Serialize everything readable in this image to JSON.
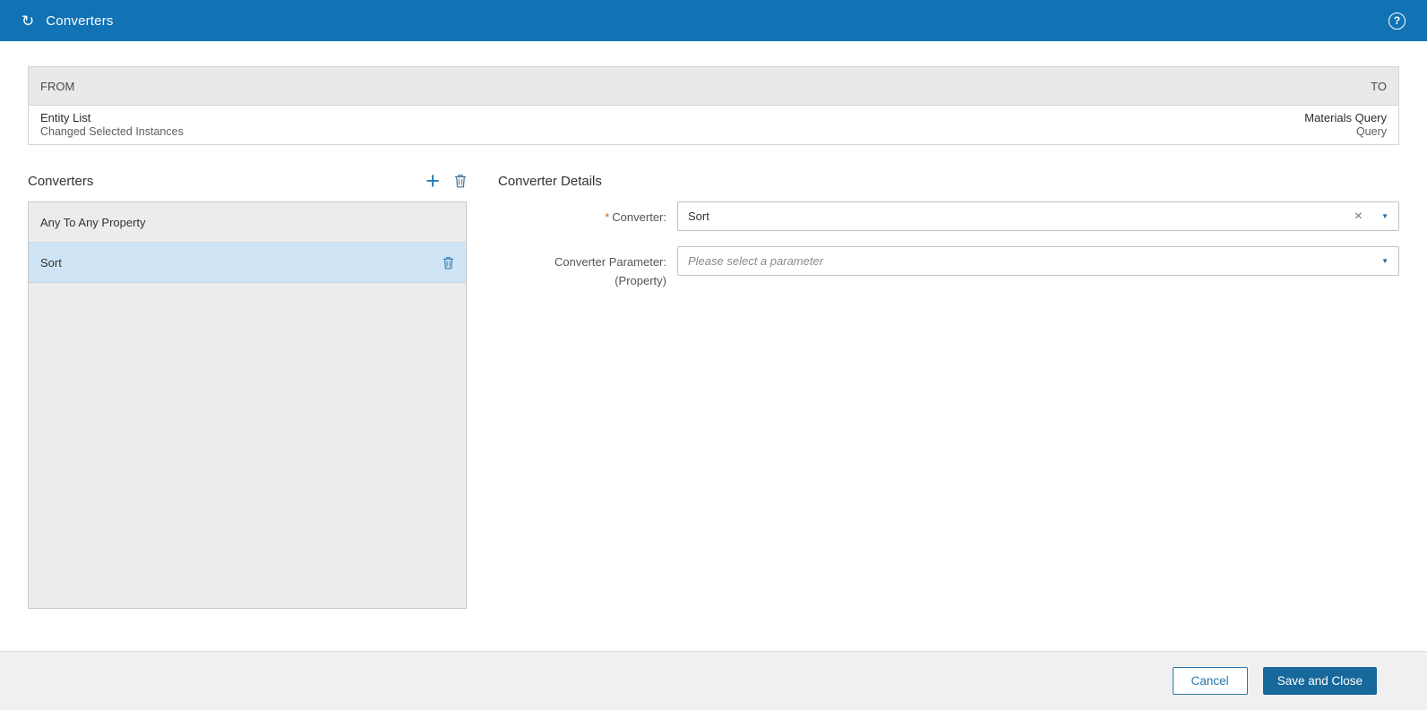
{
  "header": {
    "title": "Converters"
  },
  "icons": {
    "sync": "↻",
    "help": "?",
    "plus": "+",
    "clear": "×",
    "chevron_down": "▼"
  },
  "mapping_table": {
    "from_header": "FROM",
    "to_header": "TO",
    "row": {
      "from_title": "Entity List",
      "from_subtitle": "Changed Selected Instances",
      "to_title": "Materials Query",
      "to_subtitle": "Query"
    }
  },
  "converters_panel": {
    "title": "Converters",
    "items": [
      {
        "label": "Any To Any Property",
        "selected": false
      },
      {
        "label": "Sort",
        "selected": true
      }
    ]
  },
  "details_panel": {
    "title": "Converter Details",
    "required_marker": "*",
    "converter_field": {
      "label": "Converter:",
      "value": "Sort"
    },
    "parameter_field": {
      "label": "Converter Parameter:",
      "sublabel": "(Property)",
      "placeholder": "Please select a parameter"
    }
  },
  "footer": {
    "cancel_label": "Cancel",
    "save_label": "Save and Close"
  },
  "colors": {
    "header_blue": "#1173b4",
    "accent_blue": "#1d6fa5",
    "selected_row_blue": "#cfe4f4",
    "save_button_blue": "#17689b",
    "required_orange": "#c9621c"
  }
}
